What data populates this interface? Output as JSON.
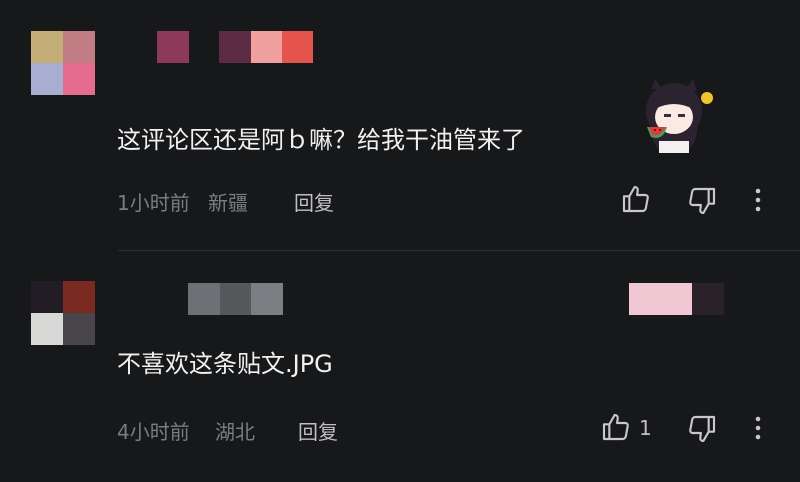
{
  "comments": [
    {
      "text": "这评论区还是阿ｂ嘛？给我干油管来了",
      "time": "1小时前",
      "location": "新疆",
      "reply_label": "回复",
      "like_count": "",
      "avatar_colors": [
        "#c3ae78",
        "#c07e84",
        "#a8aed2",
        "#e56b8f"
      ],
      "name_colors": [
        "#8d3a58",
        "#5b2c44",
        "#f1a0a0",
        "#e6544e"
      ]
    },
    {
      "text": "不喜欢这条贴文.JPG",
      "time": "4小时前",
      "location": "湖北",
      "reply_label": "回复",
      "like_count": "1",
      "avatar_colors": [
        "#221c24",
        "#7b2a22",
        "#d8d8d6",
        "#48464a"
      ],
      "name_colors": [
        "#6e7076",
        "#56585c",
        "#7c7e84",
        "#f1c7d3",
        "#f1c7d3",
        "#2a2228"
      ]
    }
  ],
  "icons": {
    "like": "thumbs-up-icon",
    "dislike": "thumbs-down-icon",
    "more": "more-vertical-icon",
    "sticker": "girl-eating-watermelon-sticker"
  },
  "colors": {
    "background": "#17181a",
    "text": "#f1f1f1",
    "meta": "#7b7c80",
    "action": "#bfbfc2"
  }
}
